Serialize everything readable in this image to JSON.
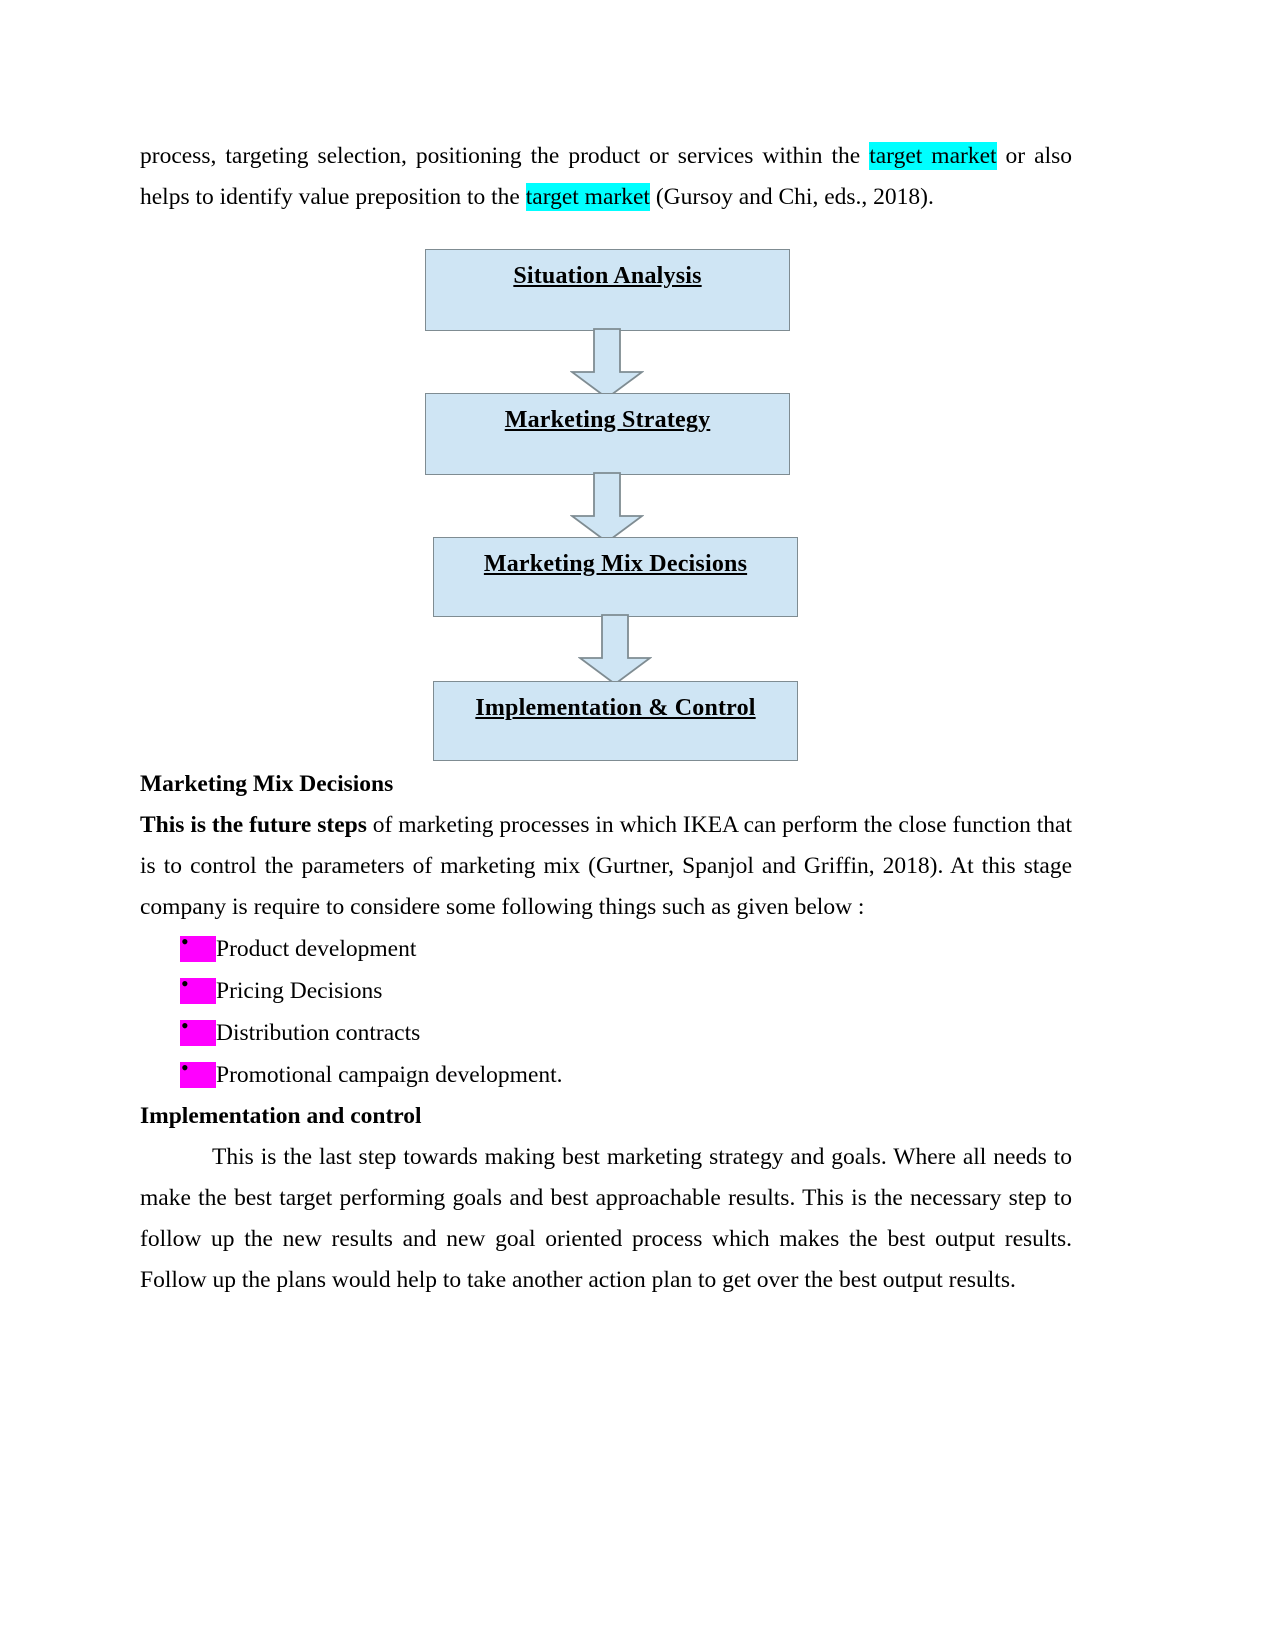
{
  "document": {
    "intro_paragraph": {
      "part1": "process, targeting selection, positioning the product or services within the ",
      "highlight1": "target market",
      "part2": " or also helps to identify value preposition to the ",
      "highlight2": "target market",
      "part3": " (Gursoy and Chi, eds., 2018)."
    },
    "flowchart": {
      "box_fill_color": "#cfe5f4",
      "box_border_color": "#7f8c92",
      "steps": [
        {
          "label": "Situation Analysis "
        },
        {
          "label": "Marketing Strategy"
        },
        {
          "label": "Marketing Mix Decisions "
        },
        {
          "label": "Implementation & Control"
        }
      ],
      "connector_icon": "down-arrow-icon"
    },
    "section_marketing_mix": {
      "heading": "Marketing Mix Decisions",
      "body_bold_lead": "This is the future steps",
      "body_rest": " of marketing processes in which IKEA can perform the close function that is to control the parameters of marketing mix (Gurtner, Spanjol and Griffin, 2018). At this stage company is require to considere some following things such as given below :",
      "bullet_highlight_color": "#ff00ff",
      "bullets": [
        "Product development",
        "Pricing Decisions",
        "Distribution contracts",
        "Promotional campaign development."
      ]
    },
    "section_implementation": {
      "heading": "Implementation and control",
      "body": "This is the last step towards making best marketing strategy and goals. Where all needs to make the best target performing goals and best approachable results. This is the necessary step to follow up the new results and new goal oriented process which makes the best output results. Follow up the plans would help to take another action plan to get over the best output results."
    },
    "colors": {
      "highlight_cyan": "#00ffff",
      "highlight_magenta": "#ff00ff",
      "page_background": "#ffffff",
      "text": "#000000"
    }
  }
}
